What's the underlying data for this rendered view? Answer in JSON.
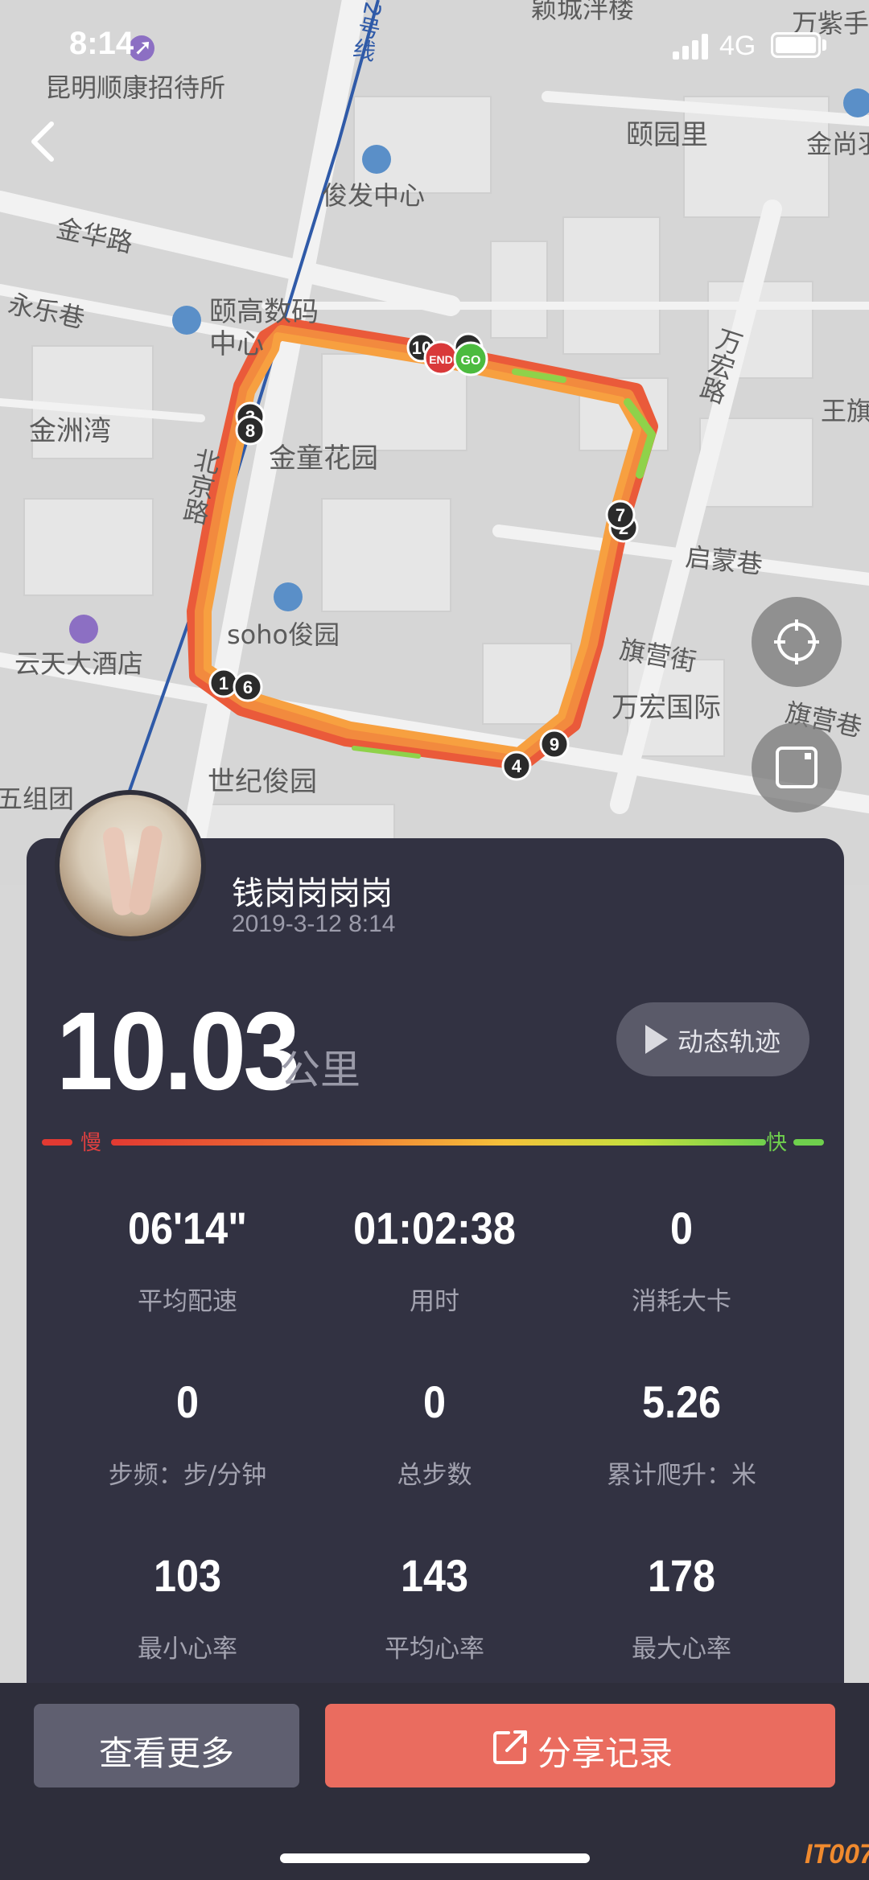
{
  "status": {
    "time": "8:14",
    "network": "4G"
  },
  "map": {
    "labels": [
      {
        "id": "kunming-hotel",
        "text": "昆明顺康招待所"
      },
      {
        "id": "junfa",
        "text": "俊发中心"
      },
      {
        "id": "jinhua-road",
        "text": "金华路"
      },
      {
        "id": "yonglexiang",
        "text": "永乐巷"
      },
      {
        "id": "yigao",
        "text": "颐高数码"
      },
      {
        "id": "yigao2",
        "text": "中心"
      },
      {
        "id": "jinzhouwan",
        "text": "金洲湾"
      },
      {
        "id": "jintong",
        "text": "金童花园"
      },
      {
        "id": "beijing-road",
        "text": "北京路"
      },
      {
        "id": "soho",
        "text": "soho俊园"
      },
      {
        "id": "yuntian",
        "text": "云天大酒店"
      },
      {
        "id": "shiji",
        "text": "世纪俊园"
      },
      {
        "id": "wanhong-guoji",
        "text": "万宏国际"
      },
      {
        "id": "qiying-street",
        "text": "旗营街"
      },
      {
        "id": "qiying-lane",
        "text": "旗营巷"
      },
      {
        "id": "qimeng",
        "text": "启蒙巷"
      },
      {
        "id": "wanhong-road",
        "text": "万宏路"
      },
      {
        "id": "yiyuanli",
        "text": "颐园里"
      },
      {
        "id": "wanzijin",
        "text": "万紫手"
      },
      {
        "id": "jinshang",
        "text": "金尚羽"
      },
      {
        "id": "wangqi",
        "text": "王旗"
      },
      {
        "id": "line2",
        "text": "2号线"
      },
      {
        "id": "wuzutuan",
        "text": "五组团"
      },
      {
        "id": "top-cut",
        "text": "颖城泮楼"
      }
    ],
    "markers": [
      "1",
      "2",
      "3",
      "4",
      "6",
      "7",
      "8",
      "9",
      "10"
    ],
    "end_label": "END",
    "go_label": "GO"
  },
  "profile": {
    "name": "钱岗岗岗岗",
    "datetime": "2019-3-12 8:14"
  },
  "summary": {
    "distance": "10.03",
    "unit": "公里",
    "replay_label": "动态轨迹",
    "slow_label": "慢",
    "fast_label": "快"
  },
  "stats": [
    {
      "value": "06'14\"",
      "label": "平均配速"
    },
    {
      "value": "01:02:38",
      "label": "用时"
    },
    {
      "value": "0",
      "label": "消耗大卡"
    },
    {
      "value": "0",
      "label": "步频：步/分钟"
    },
    {
      "value": "0",
      "label": "总步数"
    },
    {
      "value": "5.26",
      "label": "累计爬升：米"
    },
    {
      "value": "103",
      "label": "最小心率"
    },
    {
      "value": "143",
      "label": "平均心率"
    },
    {
      "value": "178",
      "label": "最大心率"
    }
  ],
  "actions": {
    "more_label": "查看更多",
    "share_label": "分享记录"
  },
  "watermark": "IT007",
  "colors": {
    "card_bg": "#323242",
    "share_button": "#ea6c5f",
    "more_button": "#5f5f70",
    "slow": "#e04040",
    "fast": "#6fd04d"
  }
}
